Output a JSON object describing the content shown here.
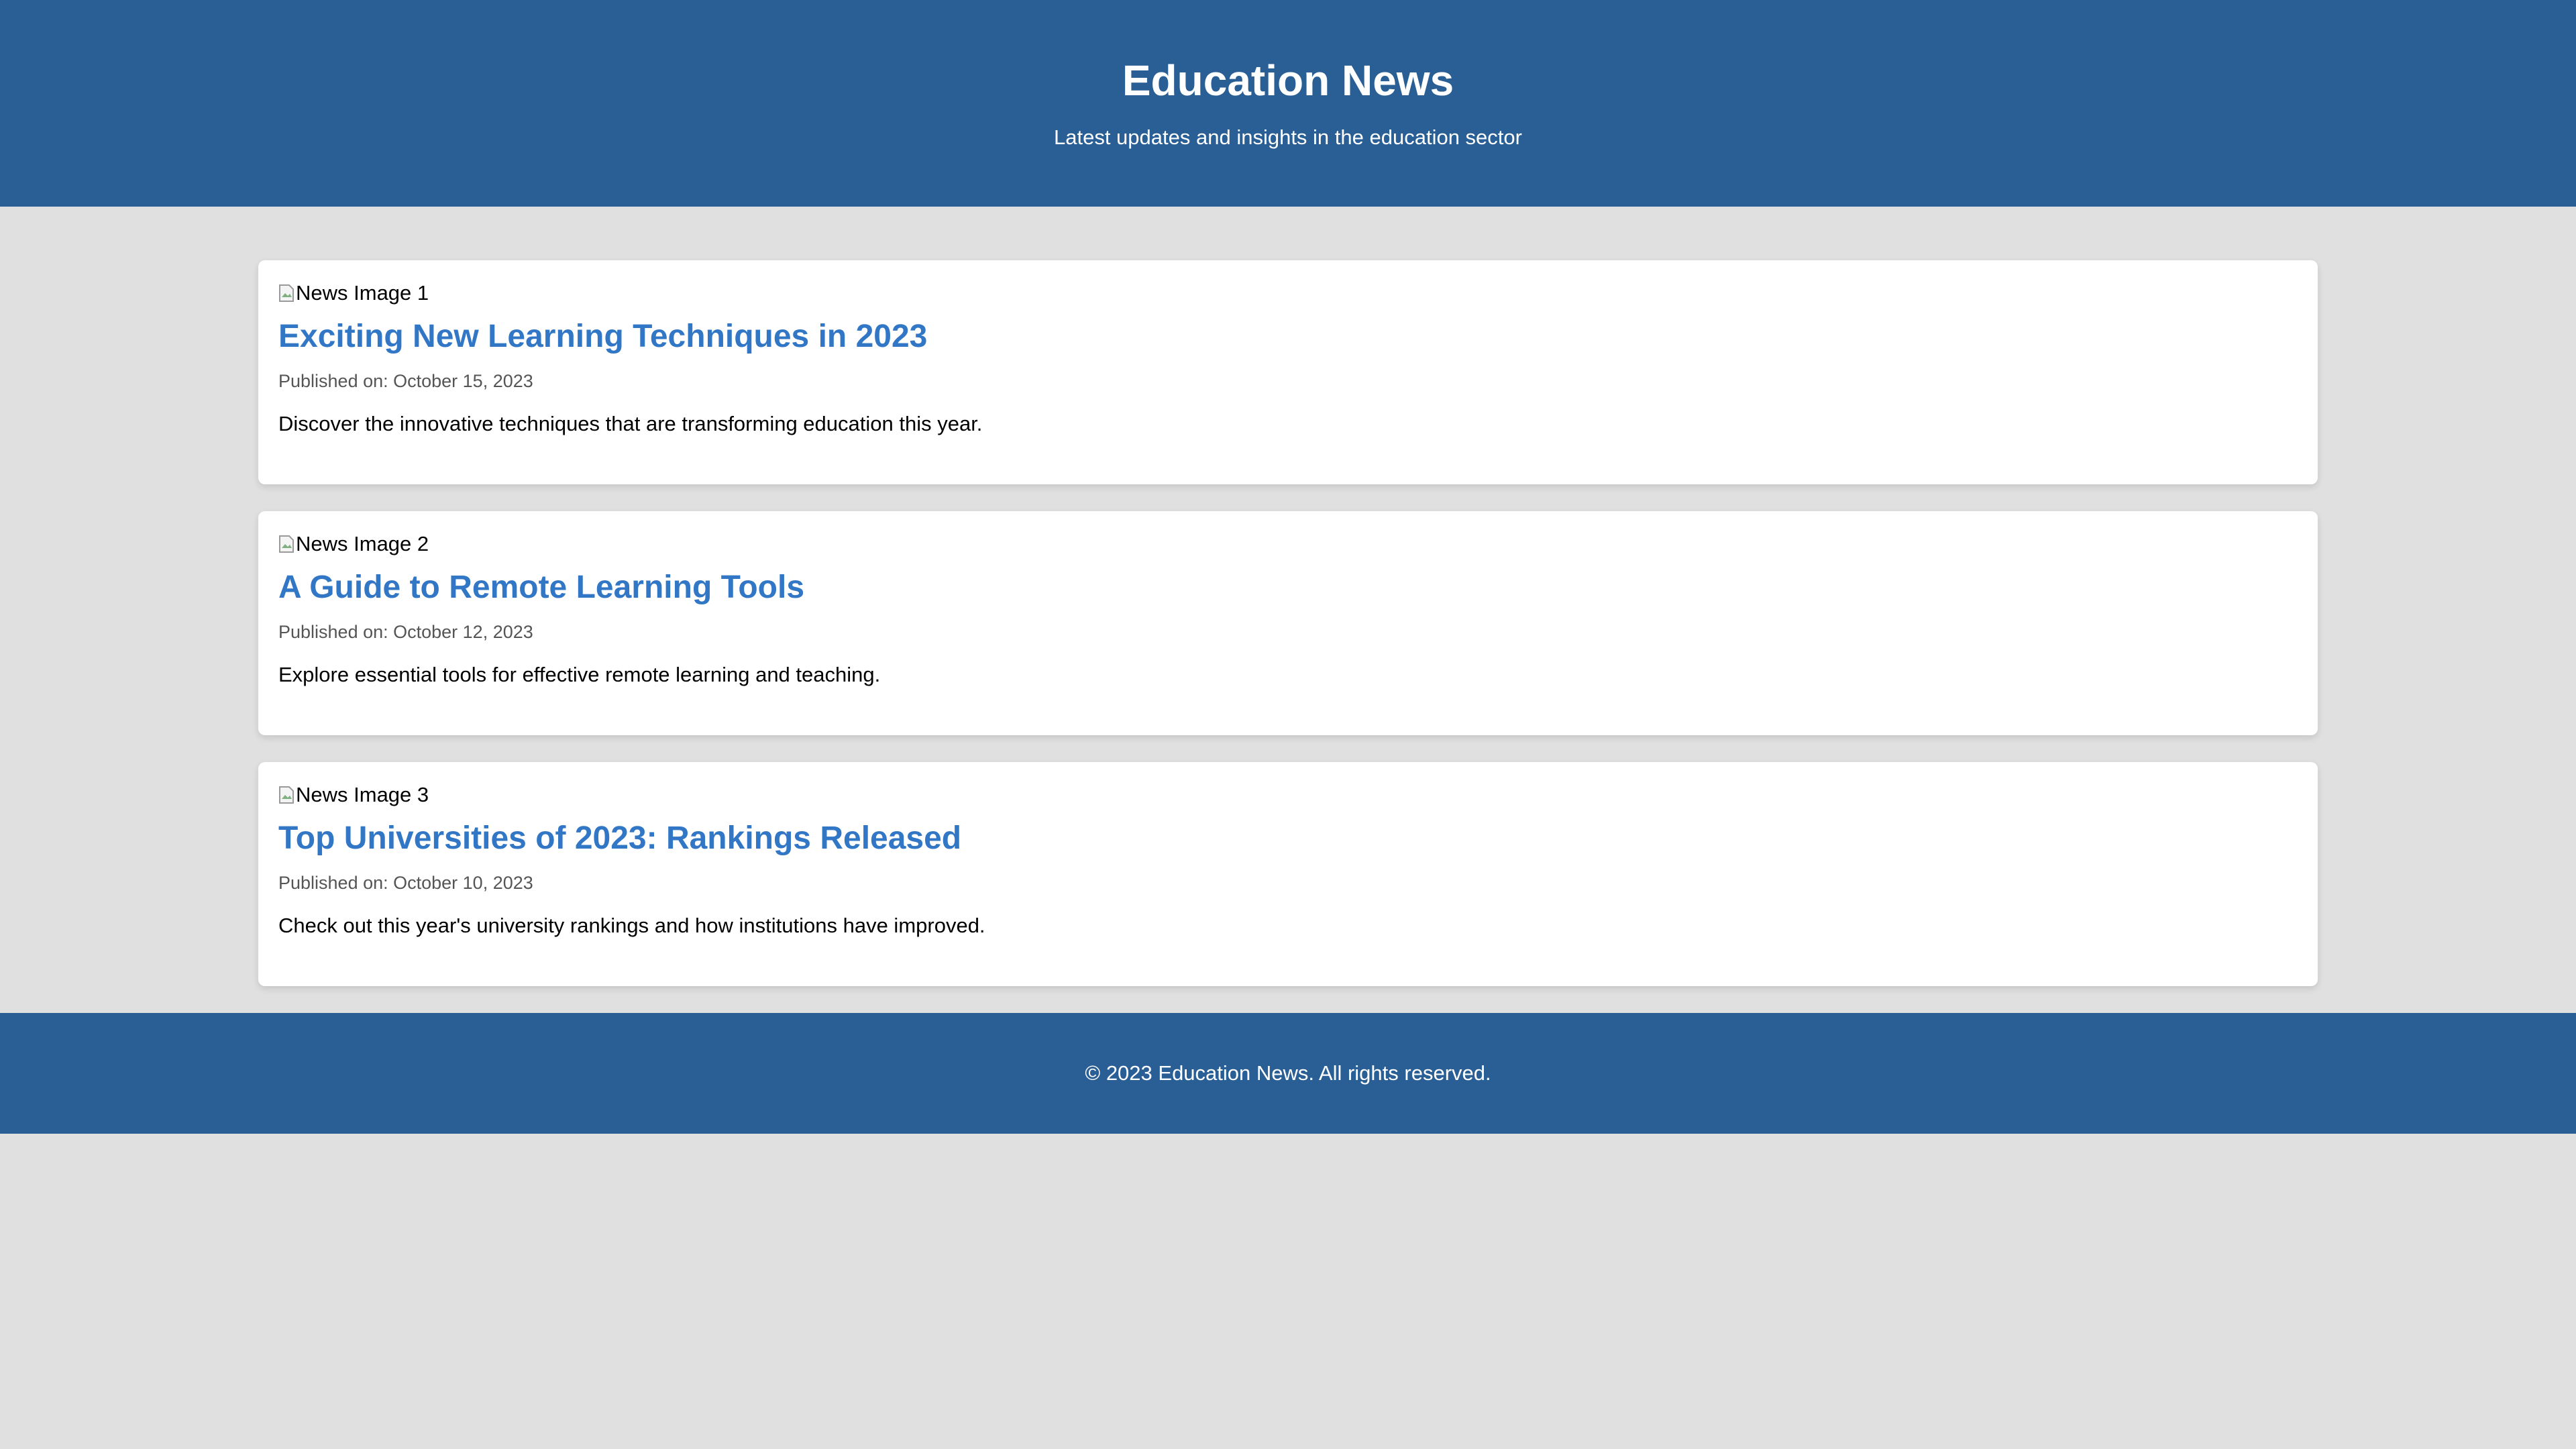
{
  "header": {
    "title": "Education News",
    "subtitle": "Latest updates and insights in the education sector"
  },
  "articles": [
    {
      "image_alt": "News Image 1",
      "title": "Exciting New Learning Techniques in 2023",
      "date": "Published on: October 15, 2023",
      "summary": "Discover the innovative techniques that are transforming education this year."
    },
    {
      "image_alt": "News Image 2",
      "title": "A Guide to Remote Learning Tools",
      "date": "Published on: October 12, 2023",
      "summary": "Explore essential tools for effective remote learning and teaching."
    },
    {
      "image_alt": "News Image 3",
      "title": "Top Universities of 2023: Rankings Released",
      "date": "Published on: October 10, 2023",
      "summary": "Check out this year's university rankings and how institutions have improved."
    }
  ],
  "footer": {
    "text": "© 2023 Education News. All rights reserved."
  },
  "colors": {
    "header_bg": "#2a5f96",
    "page_bg": "#e0e0e0",
    "title_link": "#3277c6"
  },
  "icons": {
    "image_placeholder": "broken-image-icon"
  }
}
